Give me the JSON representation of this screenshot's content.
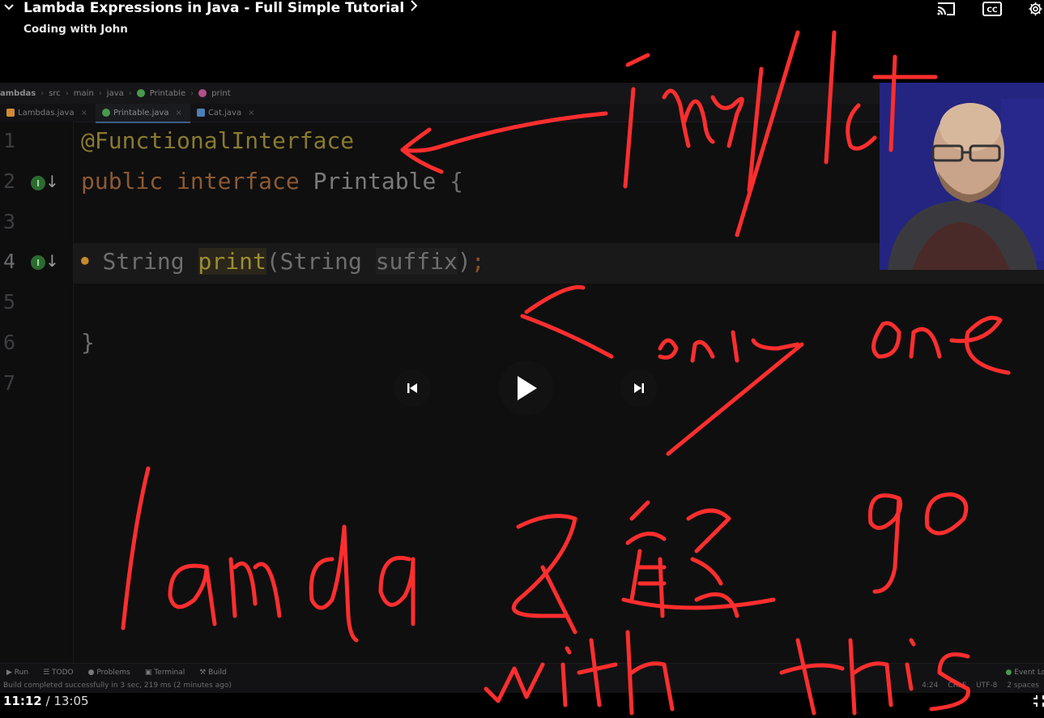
{
  "header": {
    "title": "Lambda Expressions in Java - Full Simple Tutorial",
    "channel": "Coding with John"
  },
  "breadcrumbs": [
    "ambdas",
    "src",
    "main",
    "java",
    "Printable",
    "print"
  ],
  "tabs": [
    {
      "label": "Lambdas.java",
      "color": "#d28a35"
    },
    {
      "label": "Printable.java",
      "color": "#4a9a4e"
    },
    {
      "label": "Cat.java",
      "color": "#4b7fb5"
    }
  ],
  "editor": {
    "line_numbers": [
      "1",
      "2",
      "3",
      "4",
      "5",
      "6",
      "7"
    ],
    "line1": {
      "annotation": "@FunctionalInterface"
    },
    "line2": {
      "kw1": "public",
      "kw2": "interface",
      "name": "Printable",
      "brace": "{"
    },
    "line4": {
      "type": "String",
      "method": "print",
      "open": "(",
      "ptype": "String",
      "pname": "suffix",
      "close": ")",
      "semi": ";"
    },
    "line6": {
      "brace": "}"
    }
  },
  "tool_windows": [
    "Run",
    "TODO",
    "Problems",
    "Terminal",
    "Build"
  ],
  "event_log": "Event Log",
  "status": {
    "message": "Build completed successfully in 3 sec, 219 ms (2 minutes ago)",
    "position": "4:24",
    "line_sep": "CRLF",
    "encoding": "UTF-8",
    "indent": "2 spaces"
  },
  "player": {
    "current_time": "11:12",
    "separator": " / ",
    "duration": "13:05"
  },
  "handwriting": {
    "color": "#ff2e2e",
    "notes": [
      "implict",
      "only one",
      "lamda",
      "go with this"
    ]
  },
  "icons": {
    "collapse": "chevron-down-icon",
    "title_more": "chevron-right-icon",
    "cast": "cast-icon",
    "captions": "cc-icon",
    "settings": "gear-icon",
    "prev": "skip-previous-icon",
    "play": "play-icon",
    "next": "skip-next-icon",
    "fullscreen": "exit-fullscreen-icon"
  }
}
